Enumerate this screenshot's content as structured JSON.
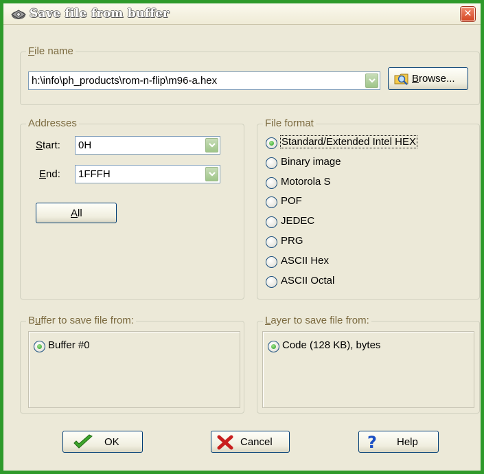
{
  "window": {
    "title": "Save file from buffer",
    "close_symbol": "✕",
    "frame_color": "#2e9a2b"
  },
  "file_name": {
    "legend_first": "F",
    "legend_rest": "ile name",
    "value": "h:\\info\\ph_products\\rom-n-flip\\m96-a.hex",
    "browse_first": "B",
    "browse_rest": "rowse..."
  },
  "addresses": {
    "legend": "Addresses",
    "start_label_first": "S",
    "start_label_rest": "tart:",
    "start_value": "0H",
    "end_label_first": "E",
    "end_label_rest": "nd:",
    "end_value": "1FFFH",
    "all_first": "A",
    "all_rest": "ll"
  },
  "file_format": {
    "legend": "File format",
    "selected_index": 0,
    "options": [
      "Standard/Extended Intel HEX",
      "Binary image",
      "Motorola S",
      "POF",
      "JEDEC",
      "PRG",
      "ASCII Hex",
      "ASCII Octal"
    ]
  },
  "buffer": {
    "legend_first": "B",
    "legend_u": "u",
    "legend_rest": "ffer to save file from:",
    "options": [
      "Buffer #0"
    ],
    "selected_index": 0
  },
  "layer": {
    "legend_first": "L",
    "legend_rest": "ayer to save file from:",
    "options": [
      "Code (128 KB), bytes"
    ],
    "selected_index": 0
  },
  "buttons": {
    "ok": "OK",
    "cancel": "Cancel",
    "help": "Help"
  },
  "icons": {
    "title": "drive-icon",
    "browse": "folder-search-icon",
    "ok": "green-checkmark-icon",
    "cancel": "red-x-icon",
    "help": "blue-question-icon"
  }
}
